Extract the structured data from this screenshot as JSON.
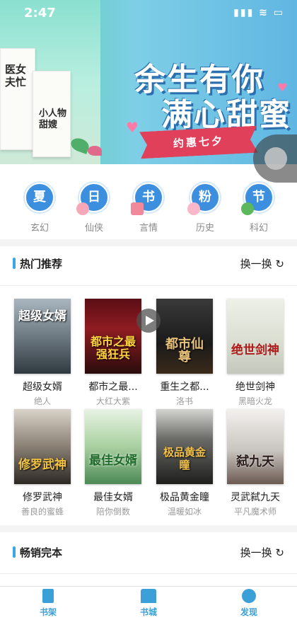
{
  "status": {
    "time": "2:47",
    "icons": "▮▮▮ ≋ ▭"
  },
  "banner": {
    "title_line1": "余生有你",
    "title_line2": "满心甜蜜",
    "ribbon": "约惠七夕",
    "book1_title": "医女夫忙",
    "book2_title": "小人物甜嫂"
  },
  "categories": [
    {
      "icon_char": "夏",
      "label": "玄幻"
    },
    {
      "icon_char": "日",
      "label": "仙侠"
    },
    {
      "icon_char": "书",
      "label": "言情"
    },
    {
      "icon_char": "粉",
      "label": "历史"
    },
    {
      "icon_char": "节",
      "label": "科幻"
    }
  ],
  "hot": {
    "title": "热门推荐",
    "refresh": "换一换 ↻",
    "books": [
      {
        "name": "超级女婿",
        "author": "绝人",
        "cover_text": "超级女婿"
      },
      {
        "name": "都市之最...",
        "author": "大红大紫",
        "cover_text": "都市之最强狂兵"
      },
      {
        "name": "重生之都...",
        "author": "洛书",
        "cover_text": "都市仙尊"
      },
      {
        "name": "绝世剑神",
        "author": "黑暗火龙",
        "cover_text": "绝世剑神"
      },
      {
        "name": "修罗武神",
        "author": "善良的蜜蜂",
        "cover_text": "修罗武神"
      },
      {
        "name": "最佳女婿",
        "author": "陪你倒数",
        "cover_text": "最佳女婿"
      },
      {
        "name": "极品黄金瞳",
        "author": "温暖如冰",
        "cover_text": "极品黄金瞳"
      },
      {
        "name": "灵武弑九天",
        "author": "平凡魔术师",
        "cover_text": "弑九天"
      }
    ]
  },
  "bestseller": {
    "title": "畅销完本",
    "refresh": "换一换 ↻"
  },
  "tabs": [
    {
      "label": "书架"
    },
    {
      "label": "书城"
    },
    {
      "label": "发现"
    }
  ]
}
